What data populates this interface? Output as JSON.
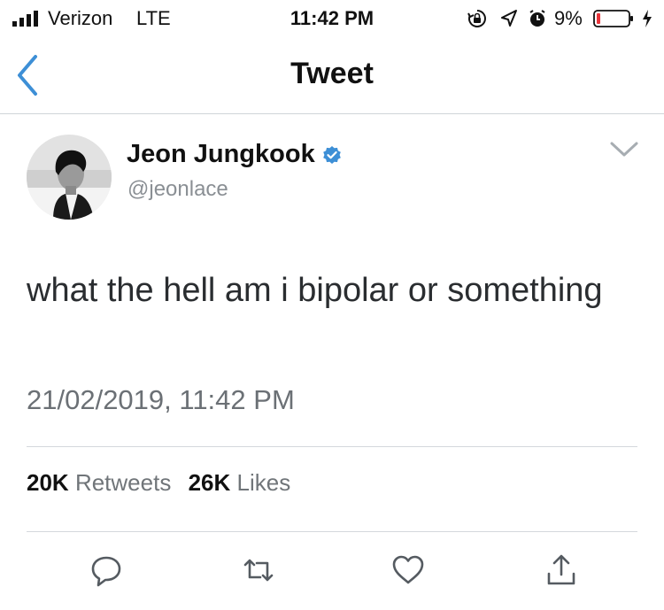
{
  "status_bar": {
    "carrier": "Verizon",
    "network": "LTE",
    "time": "11:42 PM",
    "battery_percent": "9%",
    "icons": [
      "cellular-signal-icon",
      "rotation-lock-icon",
      "location-icon",
      "alarm-icon",
      "battery-icon",
      "charging-icon"
    ]
  },
  "nav": {
    "back_icon": "chevron-left-icon",
    "title": "Tweet"
  },
  "tweet": {
    "author": {
      "name": "Jeon Jungkook",
      "handle": "@jeonlace",
      "verified": true
    },
    "text": "what the hell am i bipolar or something",
    "timestamp": "21/02/2019, 11:42 PM",
    "stats": {
      "retweets_count": "20K",
      "retweets_label": "Retweets",
      "likes_count": "26K",
      "likes_label": "Likes"
    },
    "actions": [
      "reply-icon",
      "retweet-icon",
      "like-icon",
      "share-icon"
    ]
  },
  "colors": {
    "accent": "#3d8fd6",
    "battery_low": "#e8343a",
    "text_primary": "#111111",
    "text_secondary": "#8a8f94"
  }
}
